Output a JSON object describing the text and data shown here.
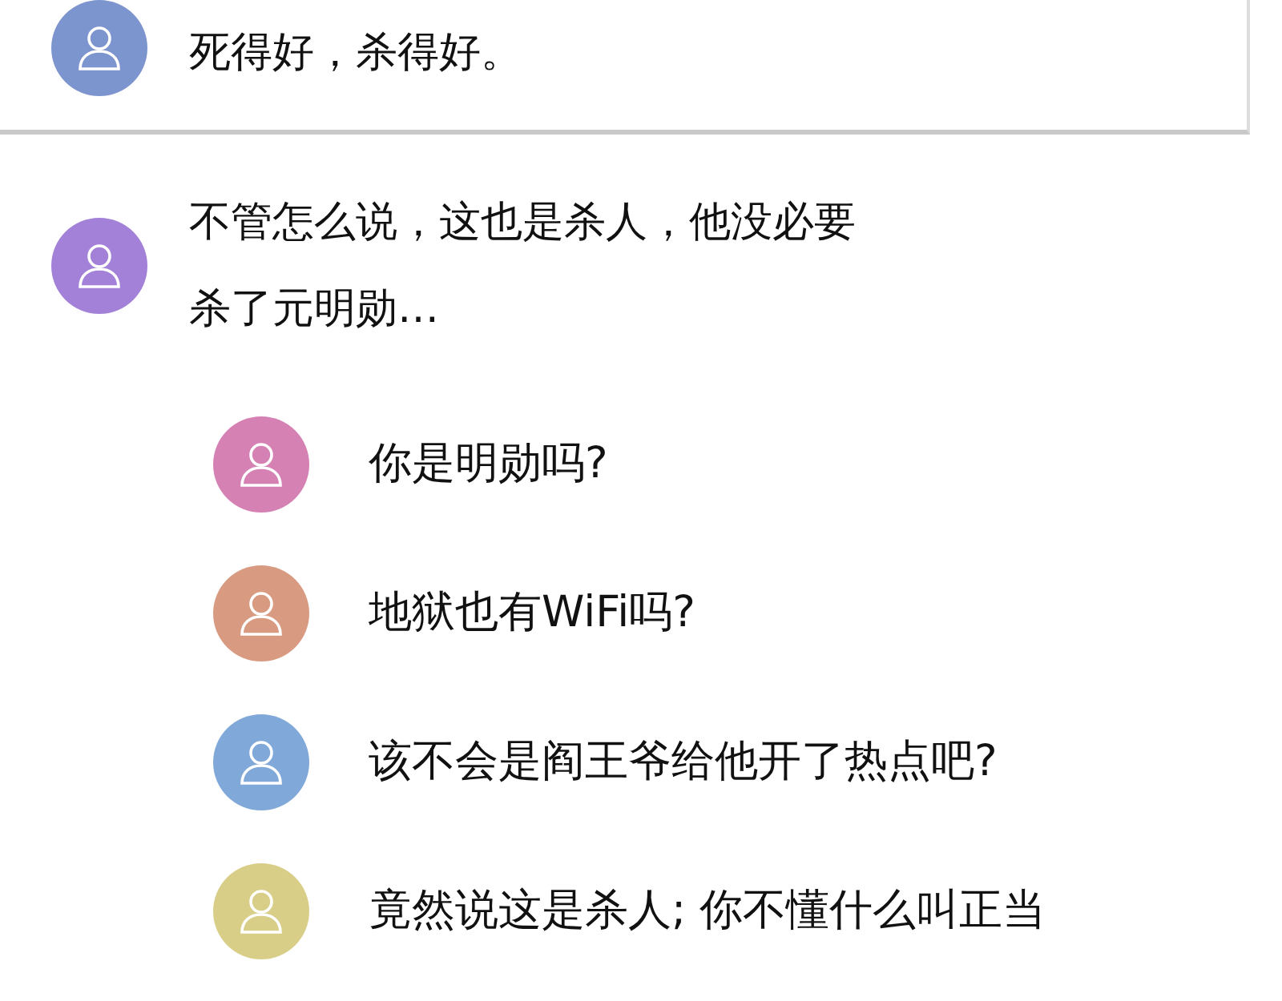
{
  "comments": [
    {
      "color": "#7d95cf",
      "text": "死得好，杀得好。"
    },
    {
      "color": "#a381d9",
      "text": "不管怎么说，这也是杀人，他没必要杀了元明勋…"
    }
  ],
  "replies": [
    {
      "color": "#d581b4",
      "text": "你是明勋吗?"
    },
    {
      "color": "#d89b82",
      "text": "地狱也有WiFi吗?"
    },
    {
      "color": "#80a8d9",
      "text": "该不会是阎王爷给他开了热点吧?"
    },
    {
      "color": "#d9ce88",
      "text": "竟然说这是杀人; 你不懂什么叫正当"
    }
  ]
}
